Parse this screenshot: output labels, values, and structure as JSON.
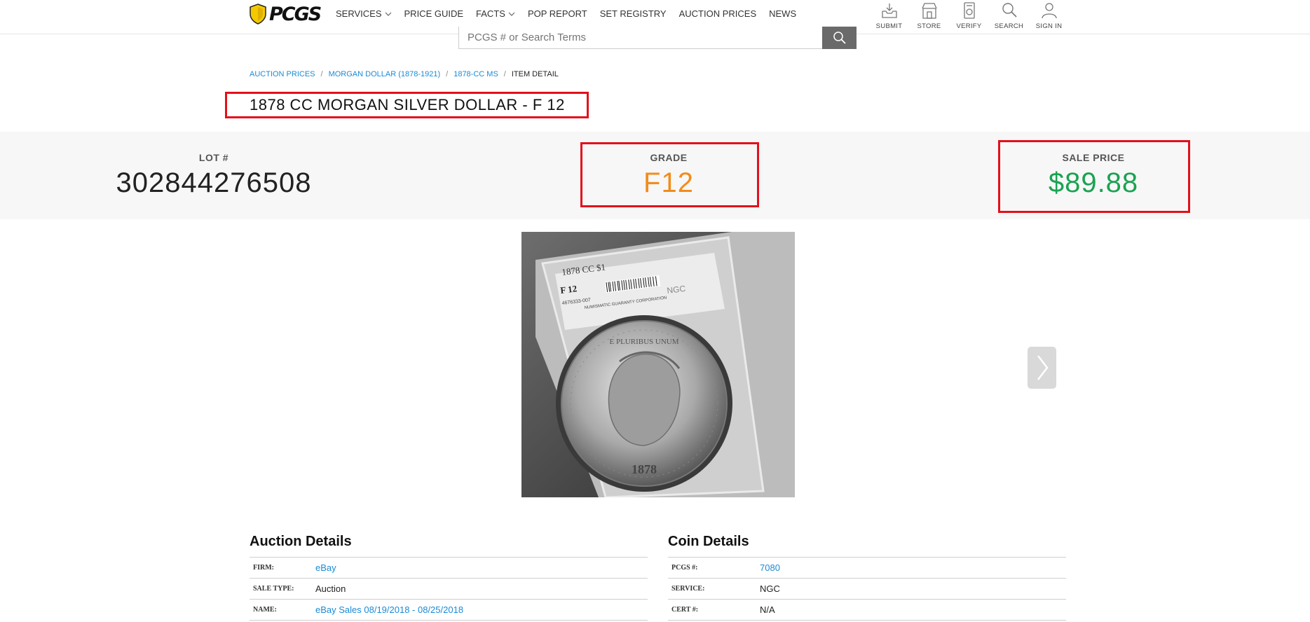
{
  "brand": {
    "logo_text": "PCGS"
  },
  "nav": {
    "links": [
      {
        "label": "SERVICES",
        "has_dropdown": true
      },
      {
        "label": "PRICE GUIDE",
        "has_dropdown": false
      },
      {
        "label": "FACTS",
        "has_dropdown": true
      },
      {
        "label": "POP REPORT",
        "has_dropdown": false
      },
      {
        "label": "SET REGISTRY",
        "has_dropdown": false
      },
      {
        "label": "AUCTION PRICES",
        "has_dropdown": false
      },
      {
        "label": "NEWS",
        "has_dropdown": false
      }
    ],
    "icons": [
      {
        "label": "SUBMIT",
        "icon": "submit-icon"
      },
      {
        "label": "STORE",
        "icon": "store-icon"
      },
      {
        "label": "VERIFY",
        "icon": "verify-icon"
      },
      {
        "label": "SEARCH",
        "icon": "search-icon"
      },
      {
        "label": "SIGN IN",
        "icon": "user-icon"
      }
    ]
  },
  "search": {
    "placeholder": "PCGS # or Search Terms",
    "value": ""
  },
  "breadcrumb": [
    {
      "label": "AUCTION PRICES",
      "current": false
    },
    {
      "label": "MORGAN DOLLAR (1878-1921)",
      "current": false
    },
    {
      "label": "1878-CC MS",
      "current": false
    },
    {
      "label": "ITEM DETAIL",
      "current": true
    }
  ],
  "title": "1878 CC MORGAN SILVER DOLLAR - F 12",
  "stats": {
    "lot": {
      "label": "LOT #",
      "value": "302844276508"
    },
    "grade": {
      "label": "GRADE",
      "value": "F12"
    },
    "sale_price": {
      "label": "SALE PRICE",
      "value": "$89.88"
    }
  },
  "colors": {
    "link": "#1a8bd6",
    "grade": "#f28c1c",
    "price": "#1aa352",
    "highlight": "#e3101b",
    "logo_shield": "#f5c900"
  },
  "coin_image": {
    "slab_line1": "1878 CC $1",
    "slab_grade": "F 12",
    "slab_cert": "4676333-007",
    "slab_company": "NUMISMATIC GUARANTY CORPORATION",
    "slab_logo": "NGC",
    "coin_year": "1878",
    "coin_legend": "E PLURIBUS UNUM"
  },
  "auction_details": {
    "heading": "Auction Details",
    "rows": [
      {
        "key": "FIRM:",
        "value": "eBay",
        "link": true
      },
      {
        "key": "SALE TYPE:",
        "value": "Auction",
        "link": false
      },
      {
        "key": "NAME:",
        "value": "eBay Sales 08/19/2018 - 08/25/2018",
        "link": true
      }
    ]
  },
  "coin_details": {
    "heading": "Coin Details",
    "rows": [
      {
        "key": "PCGS #:",
        "value": "7080",
        "link": true
      },
      {
        "key": "SERVICE:",
        "value": "NGC",
        "link": false
      },
      {
        "key": "CERT #:",
        "value": "N/A",
        "link": false
      }
    ]
  }
}
